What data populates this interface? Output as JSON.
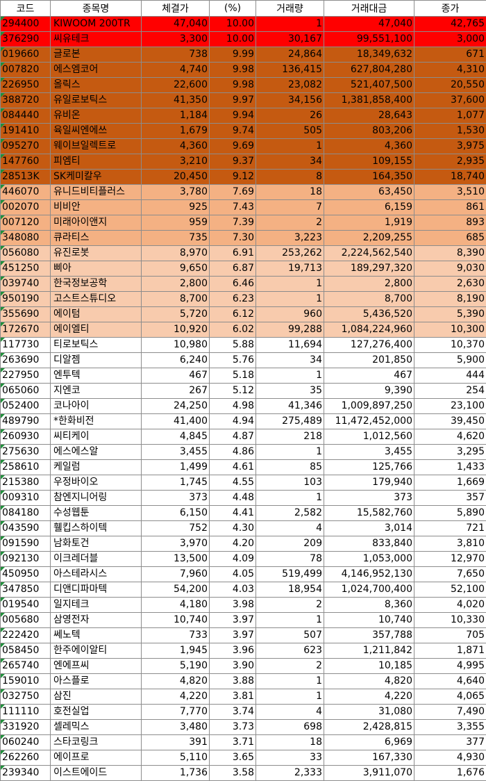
{
  "headers": [
    "코드",
    "종목명",
    "체결가",
    "(%)",
    "거래량",
    "거래대금",
    "종가"
  ],
  "tier_colors": {
    "t1": "#ff0000",
    "t2": "#c55a11",
    "t3": "#f4b183",
    "t4": "#f8cbad",
    "t5": "#ffffff"
  },
  "rows": [
    {
      "tier": "t1",
      "code": "294400",
      "name": "KIWOOM 200TR",
      "price": "47,040",
      "pct": "10.00",
      "vol": "1",
      "amount": "47,040",
      "close": "42,765"
    },
    {
      "tier": "t1",
      "code": "376290",
      "name": "씨유테크",
      "price": "3,300",
      "pct": "10.00",
      "vol": "30,167",
      "amount": "99,551,100",
      "close": "3,000"
    },
    {
      "tier": "t2",
      "code": "019660",
      "name": "글로본",
      "price": "738",
      "pct": "9.99",
      "vol": "24,864",
      "amount": "18,349,632",
      "close": "671"
    },
    {
      "tier": "t2",
      "code": "007820",
      "name": "에스엠코어",
      "price": "4,740",
      "pct": "9.98",
      "vol": "136,415",
      "amount": "627,804,280",
      "close": "4,310"
    },
    {
      "tier": "t2",
      "code": "226950",
      "name": "올릭스",
      "price": "22,600",
      "pct": "9.98",
      "vol": "23,082",
      "amount": "521,407,500",
      "close": "20,550"
    },
    {
      "tier": "t2",
      "code": "388720",
      "name": "유일로보틱스",
      "price": "41,350",
      "pct": "9.97",
      "vol": "34,156",
      "amount": "1,381,858,400",
      "close": "37,600"
    },
    {
      "tier": "t2",
      "code": "084440",
      "name": "유비온",
      "price": "1,184",
      "pct": "9.94",
      "vol": "26",
      "amount": "28,643",
      "close": "1,077"
    },
    {
      "tier": "t2",
      "code": "191410",
      "name": "육일씨엔에쓰",
      "price": "1,679",
      "pct": "9.74",
      "vol": "505",
      "amount": "803,206",
      "close": "1,530"
    },
    {
      "tier": "t2",
      "code": "095270",
      "name": "웨이브일렉트로",
      "price": "4,360",
      "pct": "9.69",
      "vol": "1",
      "amount": "4,360",
      "close": "3,975"
    },
    {
      "tier": "t2",
      "code": "147760",
      "name": "피엠티",
      "price": "3,210",
      "pct": "9.37",
      "vol": "34",
      "amount": "109,155",
      "close": "2,935"
    },
    {
      "tier": "t2",
      "code": "28513K",
      "name": "SK케미칼우",
      "price": "20,450",
      "pct": "9.12",
      "vol": "8",
      "amount": "164,350",
      "close": "18,740"
    },
    {
      "tier": "t3",
      "code": "446070",
      "name": "유니드비티플러스",
      "price": "3,780",
      "pct": "7.69",
      "vol": "18",
      "amount": "63,450",
      "close": "3,510"
    },
    {
      "tier": "t3",
      "code": "002070",
      "name": "비비안",
      "price": "925",
      "pct": "7.43",
      "vol": "7",
      "amount": "6,159",
      "close": "861"
    },
    {
      "tier": "t3",
      "code": "007120",
      "name": "미래아이앤지",
      "price": "959",
      "pct": "7.39",
      "vol": "2",
      "amount": "1,919",
      "close": "893"
    },
    {
      "tier": "t3",
      "code": "348080",
      "name": "큐라티스",
      "price": "735",
      "pct": "7.30",
      "vol": "3,223",
      "amount": "2,209,255",
      "close": "685"
    },
    {
      "tier": "t4",
      "code": "056080",
      "name": "유진로봇",
      "price": "8,970",
      "pct": "6.91",
      "vol": "253,262",
      "amount": "2,224,562,540",
      "close": "8,390"
    },
    {
      "tier": "t4",
      "code": "451250",
      "name": "삐아",
      "price": "9,650",
      "pct": "6.87",
      "vol": "19,713",
      "amount": "189,297,320",
      "close": "9,030"
    },
    {
      "tier": "t4",
      "code": "039740",
      "name": "한국정보공학",
      "price": "2,800",
      "pct": "6.46",
      "vol": "1",
      "amount": "2,800",
      "close": "2,630"
    },
    {
      "tier": "t4",
      "code": "950190",
      "name": "고스트스튜디오",
      "price": "8,700",
      "pct": "6.23",
      "vol": "1",
      "amount": "8,700",
      "close": "8,190"
    },
    {
      "tier": "t4",
      "code": "355690",
      "name": "에이텀",
      "price": "5,720",
      "pct": "6.12",
      "vol": "960",
      "amount": "5,436,520",
      "close": "5,390"
    },
    {
      "tier": "t4",
      "code": "172670",
      "name": "에이엘티",
      "price": "10,920",
      "pct": "6.02",
      "vol": "99,288",
      "amount": "1,084,224,960",
      "close": "10,300"
    },
    {
      "tier": "t5",
      "code": "117730",
      "name": "티로보틱스",
      "price": "10,980",
      "pct": "5.88",
      "vol": "11,694",
      "amount": "127,276,400",
      "close": "10,370"
    },
    {
      "tier": "t5",
      "code": "263690",
      "name": "디알젬",
      "price": "6,240",
      "pct": "5.76",
      "vol": "34",
      "amount": "201,850",
      "close": "5,900"
    },
    {
      "tier": "t5",
      "code": "227950",
      "name": "엔투텍",
      "price": "467",
      "pct": "5.18",
      "vol": "1",
      "amount": "467",
      "close": "444"
    },
    {
      "tier": "t5",
      "code": "065060",
      "name": "지엔코",
      "price": "267",
      "pct": "5.12",
      "vol": "35",
      "amount": "9,390",
      "close": "254"
    },
    {
      "tier": "t5",
      "code": "052400",
      "name": "코나아이",
      "price": "24,250",
      "pct": "4.98",
      "vol": "41,346",
      "amount": "1,009,897,250",
      "close": "23,100"
    },
    {
      "tier": "t5",
      "code": "489790",
      "name": "*한화비전",
      "price": "41,400",
      "pct": "4.94",
      "vol": "275,489",
      "amount": "11,472,452,000",
      "close": "39,450"
    },
    {
      "tier": "t5",
      "code": "260930",
      "name": "씨티케이",
      "price": "4,845",
      "pct": "4.87",
      "vol": "218",
      "amount": "1,012,560",
      "close": "4,620"
    },
    {
      "tier": "t5",
      "code": "275630",
      "name": "에스에스알",
      "price": "3,455",
      "pct": "4.86",
      "vol": "1",
      "amount": "3,455",
      "close": "3,295"
    },
    {
      "tier": "t5",
      "code": "258610",
      "name": "케일럼",
      "price": "1,499",
      "pct": "4.61",
      "vol": "85",
      "amount": "125,766",
      "close": "1,433"
    },
    {
      "tier": "t5",
      "code": "215380",
      "name": "우정바이오",
      "price": "1,745",
      "pct": "4.55",
      "vol": "103",
      "amount": "179,940",
      "close": "1,669"
    },
    {
      "tier": "t5",
      "code": "009310",
      "name": "참엔지니어링",
      "price": "373",
      "pct": "4.48",
      "vol": "1",
      "amount": "373",
      "close": "357"
    },
    {
      "tier": "t5",
      "code": "084180",
      "name": "수성웹툰",
      "price": "6,150",
      "pct": "4.41",
      "vol": "2,582",
      "amount": "15,582,760",
      "close": "5,890"
    },
    {
      "tier": "t5",
      "code": "043590",
      "name": "휄킵스하이텍",
      "price": "752",
      "pct": "4.30",
      "vol": "4",
      "amount": "3,014",
      "close": "721"
    },
    {
      "tier": "t5",
      "code": "091590",
      "name": "남화토건",
      "price": "3,970",
      "pct": "4.20",
      "vol": "209",
      "amount": "833,840",
      "close": "3,810"
    },
    {
      "tier": "t5",
      "code": "092130",
      "name": "이크레더블",
      "price": "13,500",
      "pct": "4.09",
      "vol": "78",
      "amount": "1,053,000",
      "close": "12,970"
    },
    {
      "tier": "t5",
      "code": "450950",
      "name": "아스테라시스",
      "price": "7,960",
      "pct": "4.05",
      "vol": "519,499",
      "amount": "4,146,952,130",
      "close": "7,650"
    },
    {
      "tier": "t5",
      "code": "347850",
      "name": "디앤디파마텍",
      "price": "54,200",
      "pct": "4.03",
      "vol": "18,954",
      "amount": "1,024,700,400",
      "close": "52,100"
    },
    {
      "tier": "t5",
      "code": "019540",
      "name": "일지테크",
      "price": "4,180",
      "pct": "3.98",
      "vol": "2",
      "amount": "8,360",
      "close": "4,020"
    },
    {
      "tier": "t5",
      "code": "005680",
      "name": "삼영전자",
      "price": "10,740",
      "pct": "3.97",
      "vol": "1",
      "amount": "10,740",
      "close": "10,330"
    },
    {
      "tier": "t5",
      "code": "222420",
      "name": "쎄노텍",
      "price": "733",
      "pct": "3.97",
      "vol": "507",
      "amount": "357,788",
      "close": "705"
    },
    {
      "tier": "t5",
      "code": "058450",
      "name": "한주에이알티",
      "price": "1,945",
      "pct": "3.96",
      "vol": "623",
      "amount": "1,211,842",
      "close": "1,871"
    },
    {
      "tier": "t5",
      "code": "265740",
      "name": "엔에프씨",
      "price": "5,190",
      "pct": "3.90",
      "vol": "2",
      "amount": "10,185",
      "close": "4,995"
    },
    {
      "tier": "t5",
      "code": "159010",
      "name": "아스플로",
      "price": "4,820",
      "pct": "3.88",
      "vol": "1",
      "amount": "4,820",
      "close": "4,640"
    },
    {
      "tier": "t5",
      "code": "032750",
      "name": "삼진",
      "price": "4,220",
      "pct": "3.81",
      "vol": "1",
      "amount": "4,220",
      "close": "4,065"
    },
    {
      "tier": "t5",
      "code": "111110",
      "name": "호전실업",
      "price": "7,770",
      "pct": "3.74",
      "vol": "4",
      "amount": "31,080",
      "close": "7,490"
    },
    {
      "tier": "t5",
      "code": "331920",
      "name": "셀레믹스",
      "price": "3,480",
      "pct": "3.73",
      "vol": "698",
      "amount": "2,428,815",
      "close": "3,355"
    },
    {
      "tier": "t5",
      "code": "060240",
      "name": "스타코링크",
      "price": "391",
      "pct": "3.71",
      "vol": "18",
      "amount": "6,969",
      "close": "377"
    },
    {
      "tier": "t5",
      "code": "262260",
      "name": "에이프로",
      "price": "5,110",
      "pct": "3.65",
      "vol": "33",
      "amount": "167,330",
      "close": "4,930"
    },
    {
      "tier": "t5",
      "code": "239340",
      "name": "이스트에이드",
      "price": "1,736",
      "pct": "3.58",
      "vol": "2,333",
      "amount": "3,911,070",
      "close": "1,676"
    }
  ]
}
